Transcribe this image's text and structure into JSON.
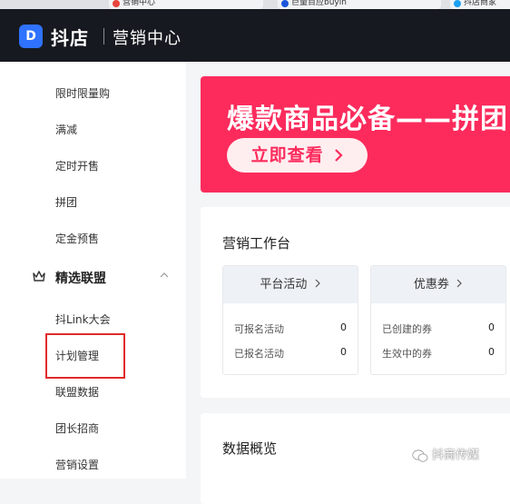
{
  "browser": {
    "tabs": [
      {
        "label": "营销中心",
        "icon": "app-icon",
        "color": "#e8453c"
      },
      {
        "label": "巨量百应buyin",
        "icon": "globe-icon",
        "color": "#1a56db"
      },
      {
        "label": "抖店商家",
        "icon": "twitter-icon",
        "color": "#1da1f2"
      }
    ]
  },
  "header": {
    "logo_glyph": "D",
    "brand": "抖店",
    "section_title": "营销中心"
  },
  "sidebar": {
    "items_top": [
      {
        "label": "限时限量购"
      },
      {
        "label": "满减"
      },
      {
        "label": "定时开售"
      },
      {
        "label": "拼团"
      },
      {
        "label": "定金预售"
      }
    ],
    "group": {
      "label": "精选联盟",
      "icon": "crown-icon",
      "expanded": true
    },
    "items_group": [
      {
        "label": "抖Link大会"
      },
      {
        "label": "计划管理",
        "highlighted": true
      },
      {
        "label": "联盟数据"
      },
      {
        "label": "团长招商"
      },
      {
        "label": "营销设置"
      }
    ]
  },
  "banner": {
    "title": "爆款商品必备——拼团",
    "button_label": "立即查看",
    "color": "#fc2b5c"
  },
  "workbench": {
    "title": "营销工作台",
    "cards": [
      {
        "title": "平台活动",
        "rows": [
          {
            "label": "可报名活动",
            "value": "0"
          },
          {
            "label": "已报名活动",
            "value": "0"
          }
        ]
      },
      {
        "title": "优惠券",
        "rows": [
          {
            "label": "已创建的券",
            "value": "0"
          },
          {
            "label": "生效中的券",
            "value": "0"
          }
        ]
      }
    ]
  },
  "overview": {
    "title": "数据概览"
  },
  "watermark": {
    "text": "抖商传媒"
  }
}
